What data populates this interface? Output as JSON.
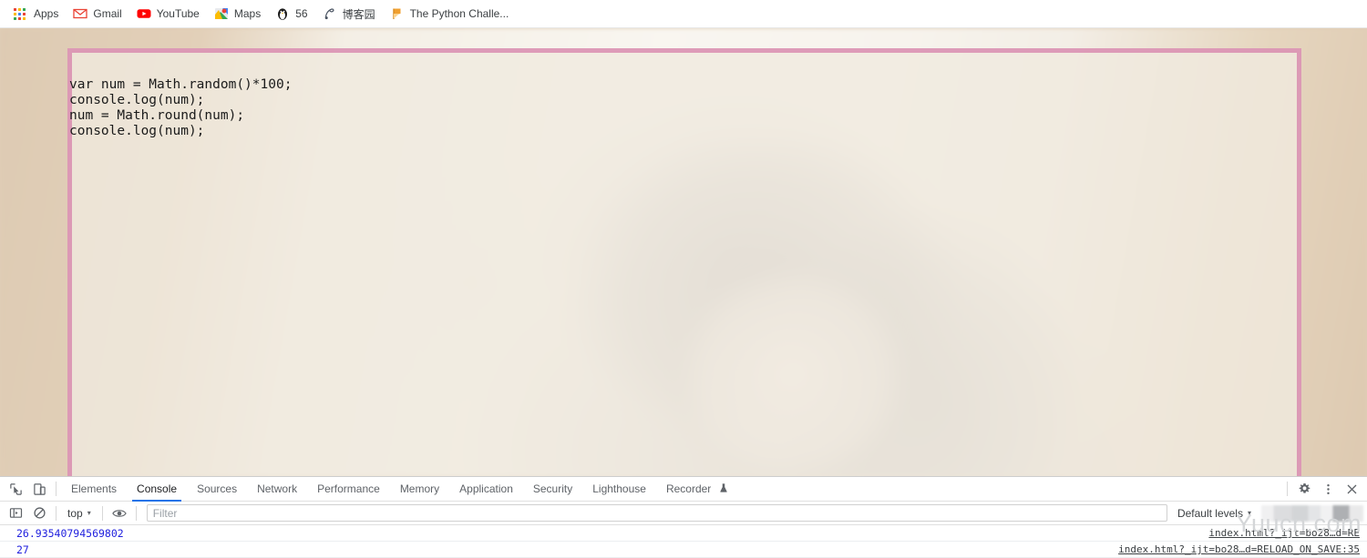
{
  "bookmarks": {
    "items": [
      {
        "label": "Apps",
        "icon": "apps-grid-icon"
      },
      {
        "label": "Gmail",
        "icon": "gmail-icon"
      },
      {
        "label": "YouTube",
        "icon": "youtube-icon"
      },
      {
        "label": "Maps",
        "icon": "google-maps-icon"
      },
      {
        "label": "56",
        "icon": "penguin-icon"
      },
      {
        "label": "博客园",
        "icon": "cnblogs-icon"
      },
      {
        "label": "The Python Challe...",
        "icon": "python-challenge-icon"
      }
    ]
  },
  "page": {
    "code": "var num = Math.random()*100;\nconsole.log(num);\nnum = Math.round(num);\nconsole.log(num);",
    "panel_background": "#f0eade",
    "panel_border_color": "#d67ca8",
    "backdrop_color": "#c09a6b"
  },
  "devtools": {
    "toolbar": {
      "inspect_icon": "inspect-element-icon",
      "device_toggle_icon": "device-toolbar-icon",
      "settings_icon": "gear-icon",
      "more_icon": "kebab-menu-icon",
      "close_icon": "close-icon"
    },
    "tabs": [
      {
        "label": "Elements",
        "active": false
      },
      {
        "label": "Console",
        "active": true
      },
      {
        "label": "Sources",
        "active": false
      },
      {
        "label": "Network",
        "active": false
      },
      {
        "label": "Performance",
        "active": false
      },
      {
        "label": "Memory",
        "active": false
      },
      {
        "label": "Application",
        "active": false
      },
      {
        "label": "Security",
        "active": false
      },
      {
        "label": "Lighthouse",
        "active": false
      },
      {
        "label": "Recorder",
        "active": false,
        "badge_icon": "beaker-icon"
      }
    ],
    "filterbar": {
      "sidebar_icon": "console-sidebar-icon",
      "clear_icon": "clear-console-icon",
      "context": "top",
      "context_caret": "▾",
      "eye_icon": "live-expression-eye-icon",
      "filter_value": "",
      "filter_placeholder": "Filter",
      "levels": "Default levels",
      "levels_caret": "▾"
    },
    "console": {
      "rows": [
        {
          "value": "26.93540794569802",
          "source": "index.html?_ijt=bo28…d=RE"
        },
        {
          "value": "27",
          "source": "index.html?_ijt=bo28…d=RELOAD_ON_SAVE:35"
        }
      ]
    }
  },
  "watermark": {
    "text": "Yuucn.com"
  },
  "colors": {
    "accent_blue": "#1a73e8",
    "console_value": "#2121de",
    "text_primary": "#202124",
    "text_secondary": "#5f6368"
  }
}
